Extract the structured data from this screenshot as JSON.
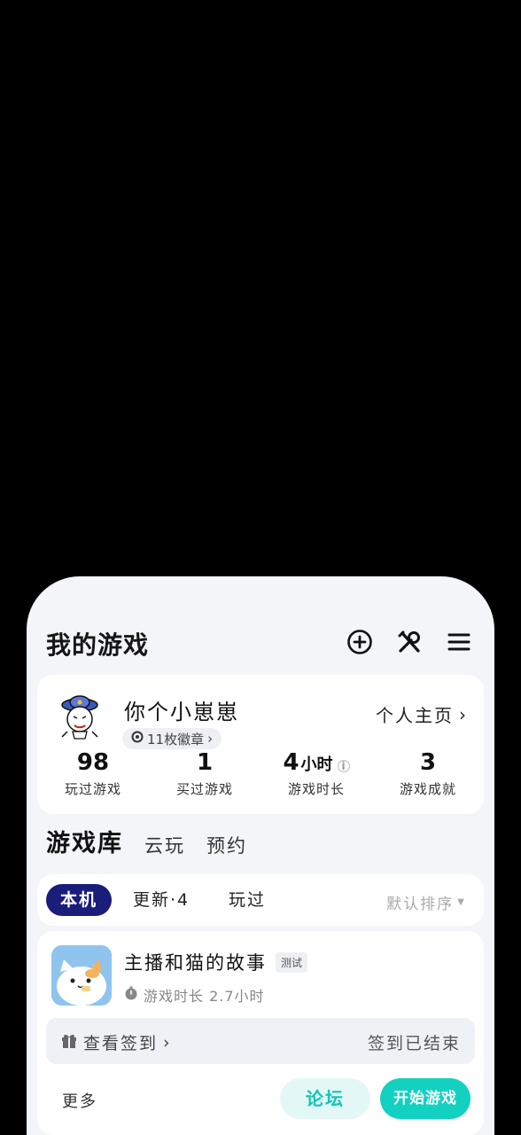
{
  "header": {
    "title": "我的游戏",
    "icons": [
      "add-circle-icon",
      "tools-icon",
      "menu-icon"
    ]
  },
  "profile": {
    "username": "你个小崽崽",
    "badges": "11枚徽章",
    "homepage_link": "个人主页",
    "stats": [
      {
        "value": "98",
        "label": "玩过游戏"
      },
      {
        "value": "1",
        "label": "买过游戏"
      },
      {
        "value": "4",
        "unit": "小时",
        "label": "游戏时长"
      },
      {
        "value": "3",
        "label": "游戏成就"
      }
    ]
  },
  "section_tabs": [
    {
      "label": "游戏库",
      "active": true
    },
    {
      "label": "云玩"
    },
    {
      "label": "预约"
    }
  ],
  "filters": {
    "chips": [
      "本机",
      "更新·4",
      "玩过"
    ],
    "sort_label": "默认排序"
  },
  "game": {
    "name": "主播和猫的故事",
    "tag": "测试",
    "playtime": "游戏时长 2.7小时",
    "checkin_link": "查看签到",
    "checkin_status": "签到已结束",
    "more_label": "更多",
    "forum_button": "论坛",
    "start_button": "开始游戏"
  },
  "colors": {
    "accent": "#13d1c0",
    "chip_active": "#1b1d7a",
    "sheet_bg": "#f3f5f9"
  }
}
